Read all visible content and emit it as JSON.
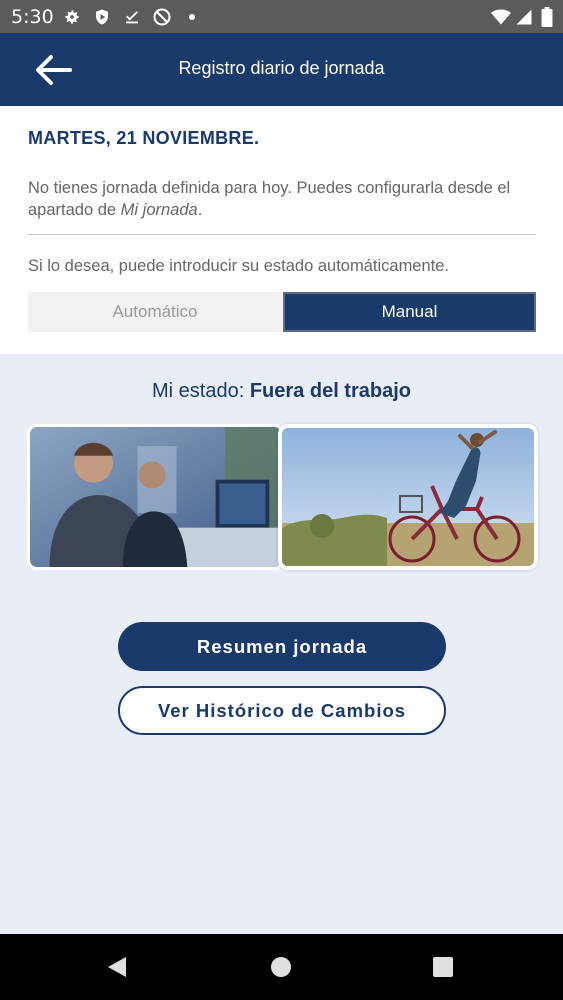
{
  "status_bar": {
    "time": "5:30",
    "icons": [
      "settings-icon",
      "shield-play-icon",
      "download-done-icon",
      "no-disturb-icon",
      "wifi-icon",
      "signal-icon",
      "battery-icon"
    ]
  },
  "app_bar": {
    "title": "Registro diario de jornada",
    "back_icon": "arrow-left-icon"
  },
  "day": {
    "date": "MARTES, 21 NOVIEMBRE.",
    "info_text": "No tienes jornada definida para hoy. Puedes configurarla desde el apartado de ",
    "info_link": "Mi jornada",
    "info_end": ".",
    "hint": "Si lo desea, puede introducir su estado automáticamente."
  },
  "mode": {
    "options": [
      "Automático",
      "Manual"
    ],
    "selected": "Manual"
  },
  "status": {
    "label": "Mi estado: ",
    "value": "Fuera del trabajo"
  },
  "buttons": {
    "summary": "Resumen jornada",
    "history": "Ver Histórico de Cambios"
  },
  "nav": [
    "back-icon",
    "home-icon",
    "recents-icon"
  ],
  "colors": {
    "primary": "#1a3a6b",
    "background": "#e9edf6"
  }
}
